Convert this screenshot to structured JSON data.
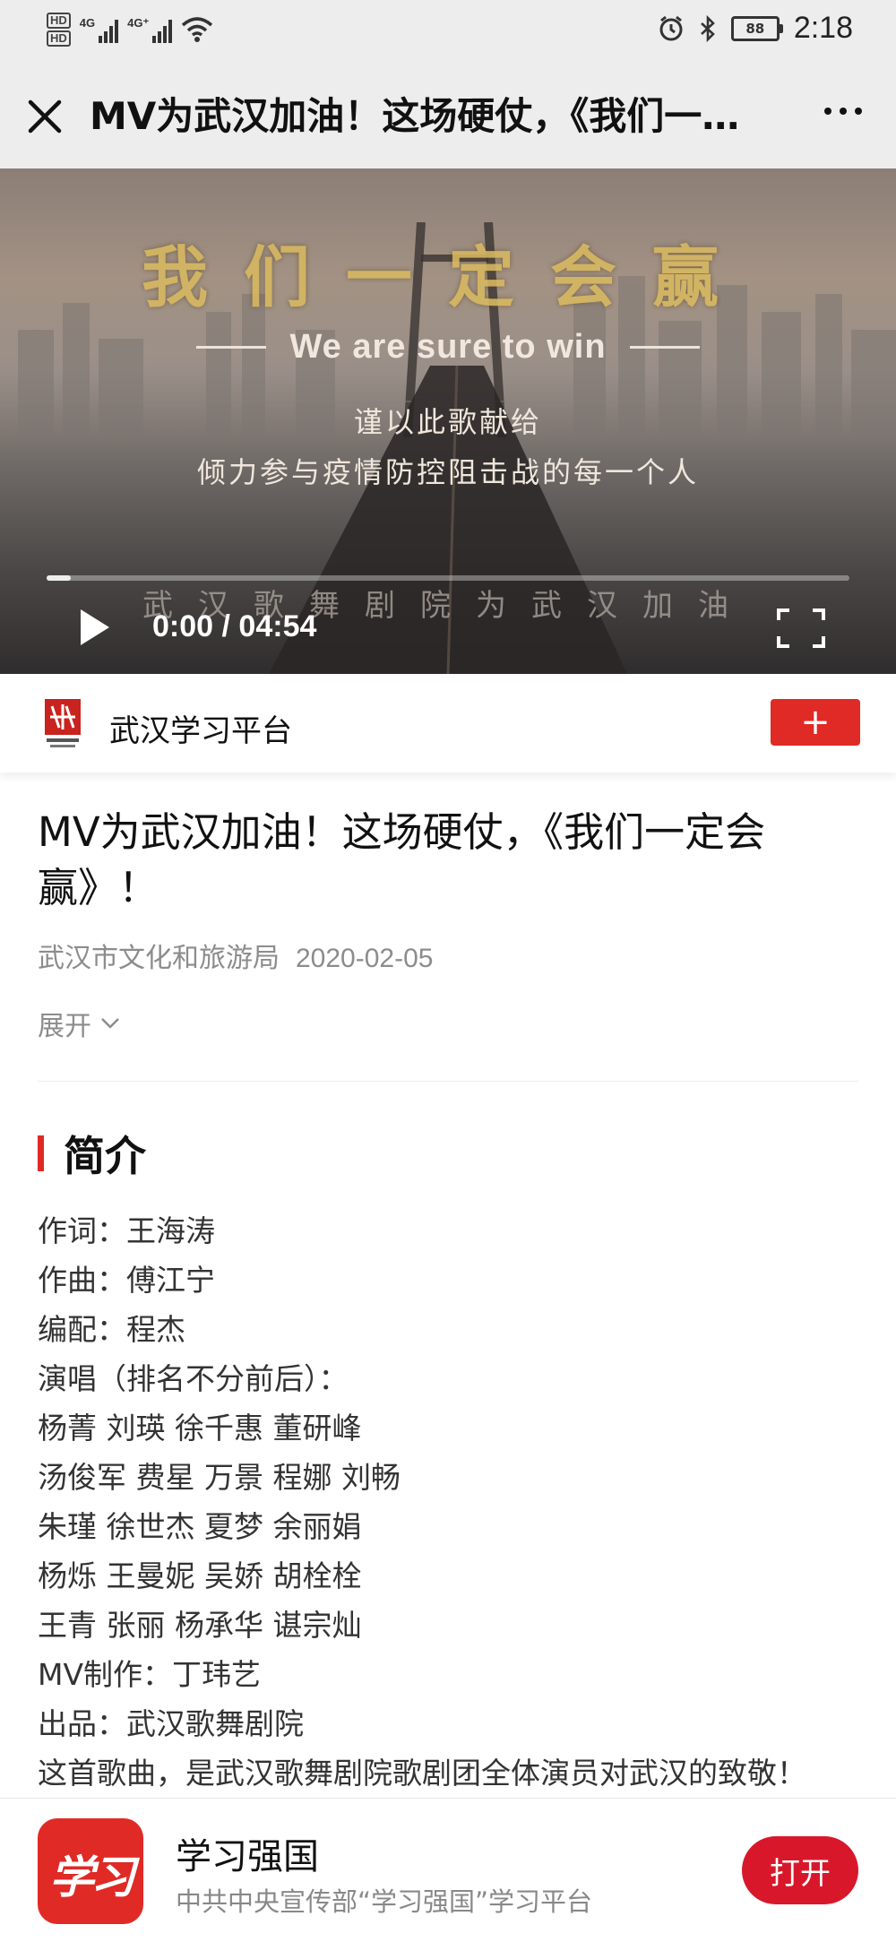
{
  "status_bar": {
    "sim1_label": "HD",
    "sim2_label": "HD",
    "network1": "4G",
    "network2": "4G⁺",
    "battery": "88",
    "time": "2:18"
  },
  "nav": {
    "title": "MV为武汉加油！这场硬仗，《我们一…"
  },
  "video": {
    "overlay_title_cn": "我们一定会赢",
    "overlay_title_en": "We are sure to win",
    "overlay_line1": "谨以此歌献给",
    "overlay_line2": "倾力参与疫情防控阻击战的每一个人",
    "overlay_line3": "武汉歌舞剧院为武汉加油",
    "current_time": "0:00",
    "separator": "/",
    "duration": "04:54",
    "progress": 0.03
  },
  "author": {
    "name": "武汉学习平台",
    "follow_label": "+"
  },
  "article": {
    "title": "MV为武汉加油！这场硬仗，《我们一定会赢》！",
    "source": "武汉市文化和旅游局",
    "date": "2020-02-05",
    "expand_label": "展开"
  },
  "intro": {
    "heading": "简介",
    "lines": [
      "作词：王海涛",
      "作曲：傅江宁",
      "编配：程杰",
      "演唱（排名不分前后）：",
      "杨菁 刘瑛 徐千惠 董研峰",
      "汤俊军 费星 万景 程娜 刘畅",
      "朱瑾 徐世杰 夏梦 余丽娟",
      "杨烁 王曼妮 吴娇 胡栓栓",
      "王青 张丽 杨承华 谌宗灿",
      "MV制作：丁玮艺",
      "出品：武汉歌舞剧院",
      "这首歌曲，是武汉歌舞剧院歌剧团全体演员对武汉的致敬！"
    ]
  },
  "app_banner": {
    "icon_text": "学习",
    "name": "学习强国",
    "description": "中共中央宣传部“学习强国”学习平台",
    "open_label": "打开"
  },
  "colors": {
    "accent_red": "#e02a25",
    "open_button": "#d8182a",
    "bar_background": "#ededed",
    "meta_gray": "#8c8c8c"
  }
}
